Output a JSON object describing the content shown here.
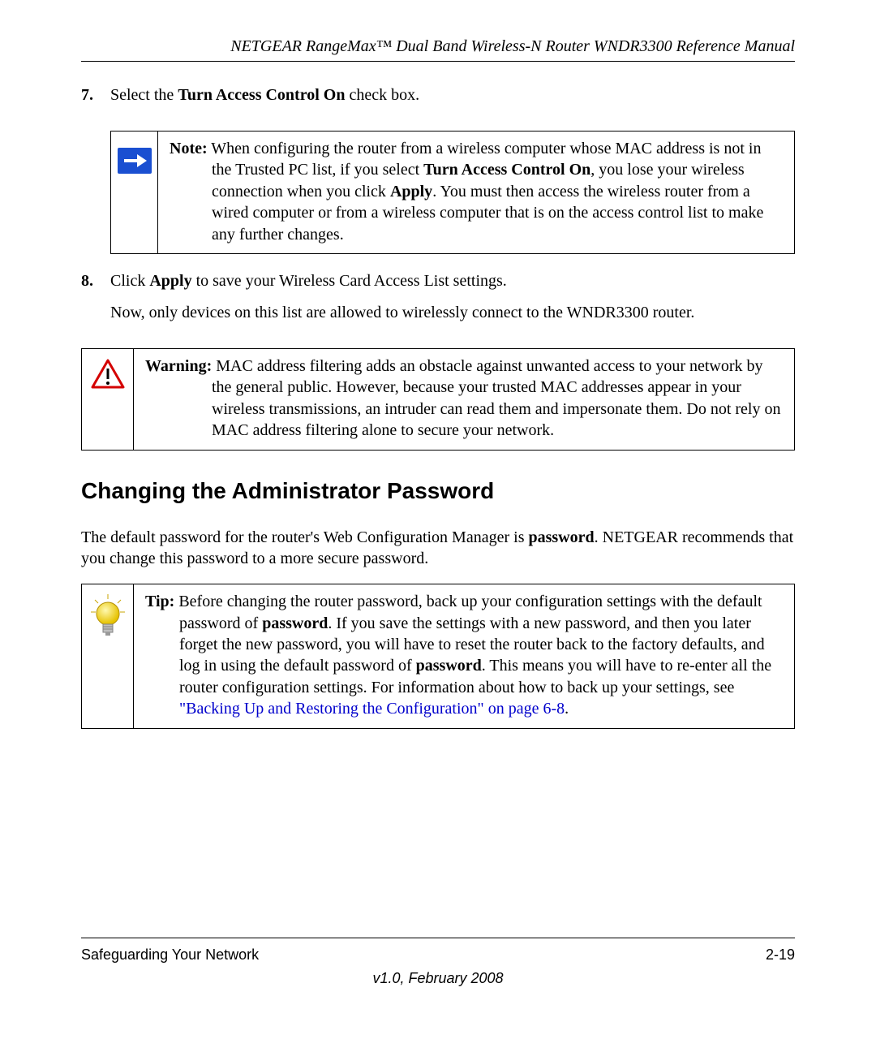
{
  "header": {
    "running": "NETGEAR RangeMax™ Dual Band Wireless-N Router WNDR3300 Reference Manual"
  },
  "step7": {
    "num": "7.",
    "pre": "Select the ",
    "bold": "Turn Access Control On",
    "post": " check box."
  },
  "note": {
    "label": "Note:",
    "t1": " When configuring the router from a wireless computer whose MAC address is not in the Trusted PC list, if you select ",
    "b1": "Turn Access Control On",
    "t2": ", you lose your wireless connection when you click ",
    "b2": "Apply",
    "t3": ". You must then access the wireless router from a wired computer or from a wireless computer that is on the access control list to make any further changes."
  },
  "step8": {
    "num": "8.",
    "l1a": "Click ",
    "l1b": "Apply",
    "l1c": " to save your Wireless Card Access List settings.",
    "l2": "Now, only devices on this list are allowed to wirelessly connect to the WNDR3300 router."
  },
  "warning": {
    "label": "Warning:",
    "body": " MAC address filtering adds an obstacle against unwanted access to your network by the general public. However, because your trusted MAC addresses appear in your wireless transmissions, an intruder can read them and impersonate them. Do not rely on MAC address filtering alone to secure your network."
  },
  "section_heading": "Changing the Administrator Password",
  "intro": {
    "t1": "The default password for the router's Web Configuration Manager is ",
    "b1": "password",
    "t2": ". NETGEAR recommends that you change this password to a more secure password."
  },
  "tip": {
    "label": "Tip:",
    "t1": " Before changing the router password, back up your configuration settings with the default password of ",
    "b1": "password",
    "t2": ". If you save the settings with a new password, and then you later forget the new password, you will have to reset the router back to the factory defaults, and log in using the default password of ",
    "b2": "password",
    "t3": ". This means you will have to re-enter all the router configuration settings. For information about how to back up your settings, see ",
    "link": "\"Backing Up and Restoring the Configuration\" on page 6-8",
    "t4": "."
  },
  "footer": {
    "left": "Safeguarding Your Network",
    "right": "2-19",
    "version": "v1.0, February 2008"
  }
}
